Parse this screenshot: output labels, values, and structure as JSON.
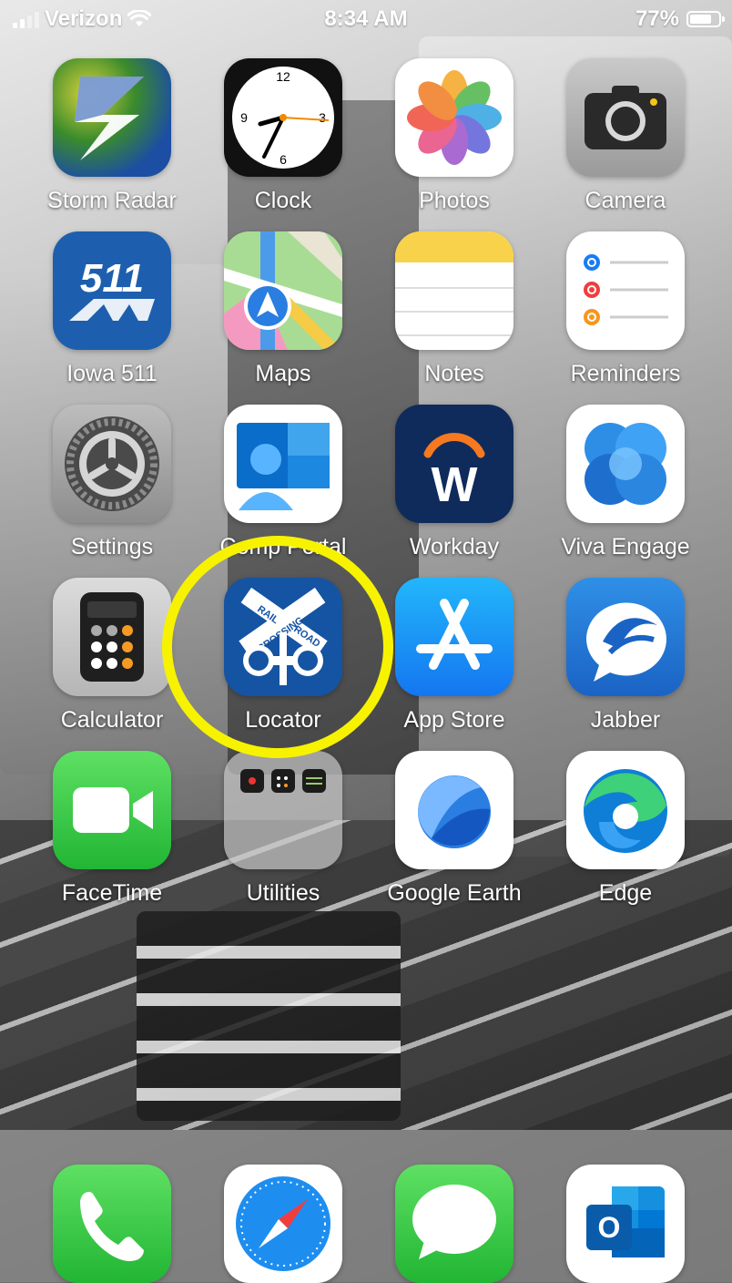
{
  "status_bar": {
    "carrier": "Verizon",
    "time": "8:34 AM",
    "battery": "77%",
    "battery_level": 0.77
  },
  "apps": [
    {
      "label": "Storm Radar",
      "icon": "storm-radar-icon"
    },
    {
      "label": "Clock",
      "icon": "clock-icon"
    },
    {
      "label": "Photos",
      "icon": "photos-icon"
    },
    {
      "label": "Camera",
      "icon": "camera-icon"
    },
    {
      "label": "Iowa 511",
      "icon": "iowa-511-icon",
      "icon_text": "511"
    },
    {
      "label": "Maps",
      "icon": "maps-icon"
    },
    {
      "label": "Notes",
      "icon": "notes-icon"
    },
    {
      "label": "Reminders",
      "icon": "reminders-icon"
    },
    {
      "label": "Settings",
      "icon": "settings-icon"
    },
    {
      "label": "Comp Portal",
      "icon": "company-portal-icon"
    },
    {
      "label": "Workday",
      "icon": "workday-icon",
      "icon_text": "W"
    },
    {
      "label": "Viva Engage",
      "icon": "viva-engage-icon"
    },
    {
      "label": "Calculator",
      "icon": "calculator-icon"
    },
    {
      "label": "Locator",
      "icon": "railroad-crossing-icon",
      "icon_text": [
        "RAIL",
        "CROSSING",
        "ROAD"
      ]
    },
    {
      "label": "App Store",
      "icon": "app-store-icon"
    },
    {
      "label": "Jabber",
      "icon": "jabber-icon"
    },
    {
      "label": "FaceTime",
      "icon": "facetime-icon"
    },
    {
      "label": "Utilities",
      "icon": "utilities-folder-icon"
    },
    {
      "label": "Google Earth",
      "icon": "google-earth-icon"
    },
    {
      "label": "Edge",
      "icon": "edge-icon"
    }
  ],
  "dock": [
    {
      "icon": "phone-icon"
    },
    {
      "icon": "safari-icon"
    },
    {
      "icon": "messages-icon"
    },
    {
      "icon": "outlook-icon",
      "icon_text": "O"
    }
  ],
  "colors": {
    "highlight": "#f7f200",
    "label": "#ffffff"
  }
}
